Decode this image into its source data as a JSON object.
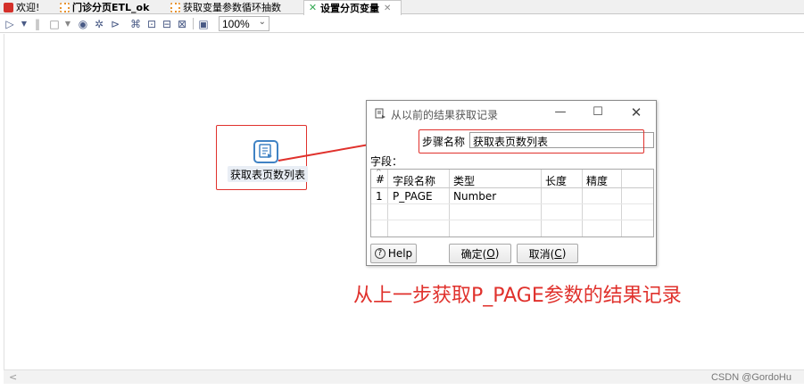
{
  "tabs": [
    {
      "label": "欢迎!",
      "icon": "welcome-icon",
      "color": "#d4302a"
    },
    {
      "label": "门诊分页ETL_ok",
      "icon": "transformation-icon",
      "color": "#e8922d"
    },
    {
      "label": "获取变量参数循环抽数",
      "icon": "transformation-icon",
      "color": "#e8922d"
    },
    {
      "label": "设置分页变量",
      "icon": "transformation-icon",
      "color": "#34a853",
      "active": true
    }
  ],
  "toolbar": {
    "zoom_value": "100%"
  },
  "canvas": {
    "step_label": "获取表页数列表"
  },
  "dialog": {
    "title": "从以前的结果获取记录",
    "step_name_label": "步骤名称",
    "step_name_value": "获取表页数列表",
    "fields_label": "字段：",
    "columns": [
      "#",
      "字段名称",
      "类型",
      "长度",
      "精度"
    ],
    "rows": [
      [
        "1",
        "P_PAGE",
        "Number",
        "",
        ""
      ]
    ],
    "help_label": "Help",
    "ok_label": "确定(",
    "ok_key": "O",
    "ok_suffix": ")",
    "cancel_label": "取消(",
    "cancel_key": "C",
    "cancel_suffix": ")"
  },
  "annotation": "从上一步获取P_PAGE参数的结果记录",
  "watermark": "CSDN @GordoHu",
  "colors": {
    "highlight": "#e0312c",
    "step_icon": "#3f82c4"
  }
}
